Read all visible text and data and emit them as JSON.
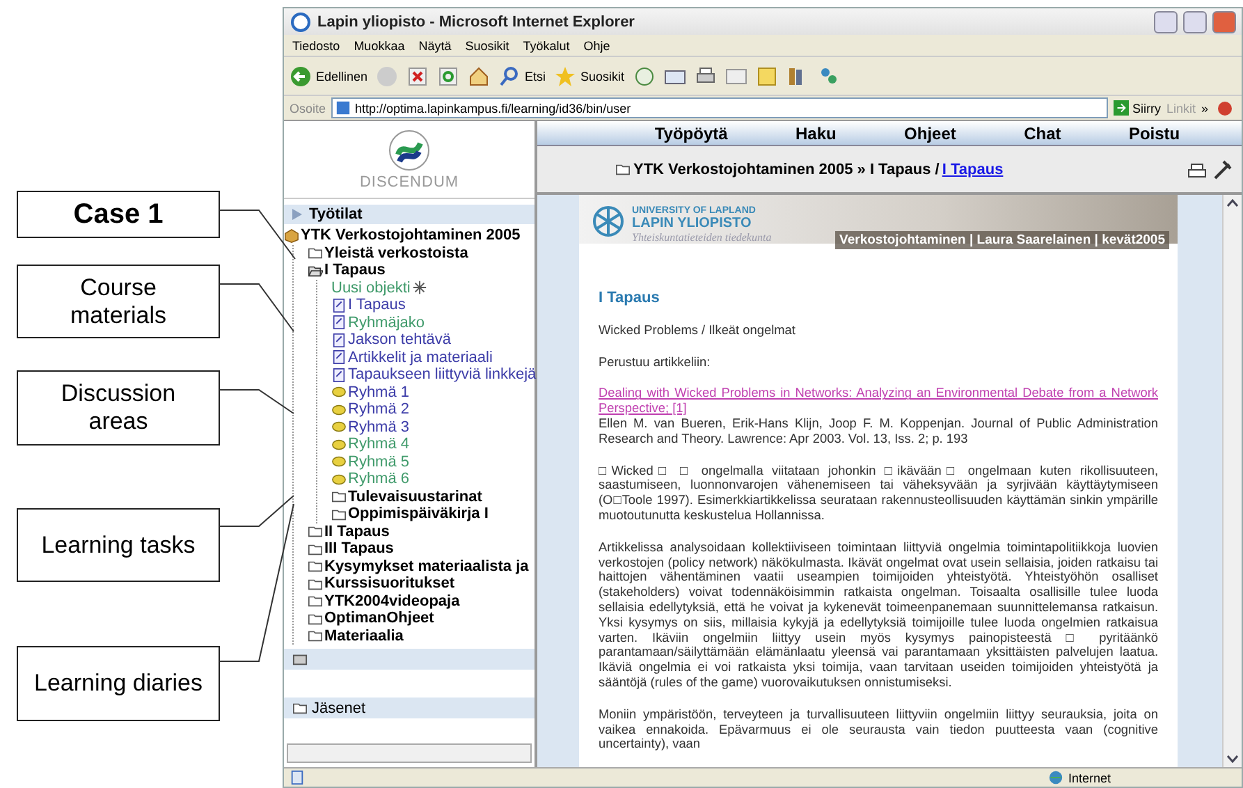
{
  "callouts": [
    {
      "text": "Case 1",
      "bold": true
    },
    {
      "text": "Course materials",
      "bold": false
    },
    {
      "text": "Discussion areas",
      "bold": false
    },
    {
      "text": "Learning tasks",
      "bold": false
    },
    {
      "text": "Learning diaries",
      "bold": false
    }
  ],
  "window": {
    "title": "Lapin yliopisto - Microsoft Internet Explorer"
  },
  "menu": [
    "Tiedosto",
    "Muokkaa",
    "Näytä",
    "Suosikit",
    "Työkalut",
    "Ohje"
  ],
  "toolbar": {
    "back": "Edellinen",
    "search": "Etsi",
    "favorites": "Suosikit"
  },
  "address": {
    "label": "Osoite",
    "url": "http://optima.lapinkampus.fi/learning/id36/bin/user",
    "go": "Siirry",
    "links": "Linkit",
    "more": "»"
  },
  "logo": {
    "text": "DISCENDUM"
  },
  "sidebar": {
    "header": "Työtilat",
    "footer": "Jäsenet",
    "tree": [
      {
        "label": "YTK Verkostojohtaminen 2005",
        "kind": "course",
        "color": "#000000",
        "children": [
          {
            "label": "Yleistä verkostoista",
            "kind": "folder",
            "color": "#000000"
          },
          {
            "label": "I Tapaus",
            "kind": "folder-open",
            "color": "#000000",
            "children": [
              {
                "label": "Uusi objekti",
                "kind": "new",
                "color": "#3f9a6a"
              },
              {
                "label": "I Tapaus",
                "kind": "page",
                "color": "#3c3ca8"
              },
              {
                "label": "Ryhmäjako",
                "kind": "page",
                "color": "#3f9a6a"
              },
              {
                "label": "Jakson tehtävä",
                "kind": "page",
                "color": "#3c3ca8"
              },
              {
                "label": "Artikkelit ja materiaali",
                "kind": "page",
                "color": "#3c3ca8"
              },
              {
                "label": "Tapaukseen liittyviä linkkejä",
                "kind": "page",
                "color": "#3c3ca8"
              },
              {
                "label": "Ryhmä 1",
                "kind": "discussion",
                "color": "#3c3ca8"
              },
              {
                "label": "Ryhmä 2",
                "kind": "discussion",
                "color": "#3c3ca8"
              },
              {
                "label": "Ryhmä 3",
                "kind": "discussion",
                "color": "#3c3ca8"
              },
              {
                "label": "Ryhmä 4",
                "kind": "discussion",
                "color": "#3f9a6a"
              },
              {
                "label": "Ryhmä 5",
                "kind": "discussion",
                "color": "#3f9a6a"
              },
              {
                "label": "Ryhmä 6",
                "kind": "discussion",
                "color": "#3f9a6a"
              },
              {
                "label": "Tulevaisuustarinat",
                "kind": "folder",
                "color": "#000000"
              },
              {
                "label": "Oppimispäiväkirja I",
                "kind": "folder",
                "color": "#000000"
              }
            ]
          },
          {
            "label": "II Tapaus",
            "kind": "folder",
            "color": "#000000"
          },
          {
            "label": "III Tapaus",
            "kind": "folder",
            "color": "#000000"
          },
          {
            "label": "Kysymykset materiaalista ja",
            "kind": "folder",
            "color": "#000000"
          },
          {
            "label": "Kurssisuoritukset",
            "kind": "folder",
            "color": "#000000"
          },
          {
            "label": "YTK2004videopaja",
            "kind": "folder",
            "color": "#000000"
          },
          {
            "label": "OptimanOhjeet",
            "kind": "folder",
            "color": "#000000"
          },
          {
            "label": "Materiaalia",
            "kind": "folder",
            "color": "#000000"
          }
        ]
      }
    ]
  },
  "nav": [
    "Työpöytä",
    "Haku",
    "Ohjeet",
    "Chat",
    "Poistu"
  ],
  "breadcrumb": {
    "path": "YTK Verkostojohtaminen 2005 » I Tapaus / ",
    "current": "I Tapaus"
  },
  "banner": {
    "university": "UNIVERSITY OF LAPLAND",
    "name": "LAPIN YLIOPISTO",
    "faculty": "Yhteiskuntatieteiden tiedekunta",
    "course": "Verkostojohtaminen | Laura Saarelainen | kevät2005"
  },
  "article": {
    "heading": "I Tapaus",
    "subtitle": "Wicked Problems / Ilkeät ongelmat",
    "intro": "Perustuu artikkeliin:",
    "link": "Dealing with Wicked Problems in Networks: Analyzing an Environmental Debate from a Network Perspective; [1]",
    "citation": "Ellen M. van Bueren, Erik-Hans Klijn, Joop F. M. Koppenjan. Journal of Public Administration Research and Theory. Lawrence: Apr 2003. Vol. 13, Iss. 2; p. 193",
    "paragraphs": [
      "□Wicked□ □ ongelmalla viitataan johonkin □ikävään□ ongelmaan kuten rikollisuuteen, saastumiseen, luonnonvarojen vähenemiseen tai väheksyvään ja syrjivään käyttäytymiseen (O□Toole 1997). Esimerkkiartikkelissa seurataan rakennusteollisuuden käyttämän sinkin ympärille muotoutunutta keskustelua Hollannissa.",
      "Artikkelissa analysoidaan kollektiiviseen toimintaan liittyviä ongelmia toimintapolitiikkoja luovien verkostojen (policy network) näkökulmasta. Ikävät ongelmat ovat usein sellaisia, joiden ratkaisu tai haittojen vähentäminen vaatii useampien toimijoiden yhteistyötä. Yhteistyöhön osalliset (stakeholders) voivat todennäköisimmin ratkaista ongelman. Toisaalta osallisille tulee luoda sellaisia edellytyksiä, että he voivat ja kykenevät toimeenpanemaan suunnittelemansa ratkaisun. Yksi kysymys on siis, millaisia kykyjä ja edellytyksiä toimijoille tulee luoda ongelmien ratkaisua varten. Ikäviin ongelmiin liittyy usein myös kysymys painopisteestä □ pyritäänkö parantamaan/säilyttämään elämänlaatu yleensä vai parantamaan yksittäisten palvelujen laatua. Ikäviä ongelmia ei voi ratkaista yksi toimija, vaan tarvitaan useiden toimijoiden yhteistyötä ja sääntöjä (rules of the game) vuorovaikutuksen onnistumiseksi.",
      "Moniin ympäristöön, terveyteen ja turvallisuuteen liittyviin ongelmiin liittyy seurauksia, joita on vaikea ennakoida. Epävarmuus ei ole seurausta vain tiedon puutteesta vaan (cognitive uncertainty), vaan"
    ]
  },
  "status_bar": {
    "zone": "Internet"
  }
}
